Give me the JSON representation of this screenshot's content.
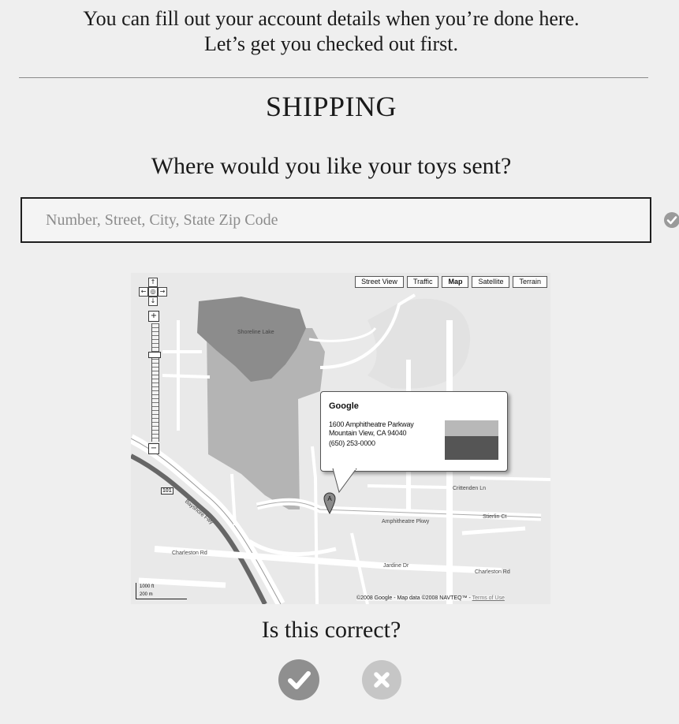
{
  "intro": {
    "line1": "You can fill out your account details when you’re done here.",
    "line2": "Let’s get you checked out first."
  },
  "section": {
    "title": "SHIPPING"
  },
  "address": {
    "question": "Where would you like your toys sent?",
    "placeholder": "Number, Street, City, State Zip Code",
    "value": "",
    "validation_icon": "check-circle-icon"
  },
  "map": {
    "map_types": [
      {
        "label": "Street View",
        "active": false
      },
      {
        "label": "Traffic",
        "active": false
      },
      {
        "label": "Map",
        "active": true
      },
      {
        "label": "Satellite",
        "active": false
      },
      {
        "label": "Terrain",
        "active": false
      }
    ],
    "info_window": {
      "name": "Google",
      "address_line1": "1600 Amphitheatre Parkway",
      "address_line2": "Mountain View, CA 94040",
      "phone": "(650) 253-0000"
    },
    "marker_label": "A",
    "copyright": "©2008 Google - Map data ©2008 NAVTEQ™ -",
    "terms": "Terms of Use",
    "scale": {
      "top": "1000 ft",
      "bottom": "200 m"
    },
    "street_labels": {
      "amphitheatre": "Amphitheatre Pkwy",
      "charleston_rd": "Charleston Rd",
      "charleston_rd_east": "Charleston Rd",
      "bayshore": "Bayshore Fwy",
      "jardine": "Jardine Dr",
      "shoreline_lake": "Shoreline Lake",
      "stierlin": "Stierlin Ct",
      "crittenden": "Crittenden Ln",
      "hwy_101": "101"
    }
  },
  "confirm": {
    "question": "Is this correct?",
    "yes_icon": "check-icon",
    "no_icon": "x-icon"
  }
}
